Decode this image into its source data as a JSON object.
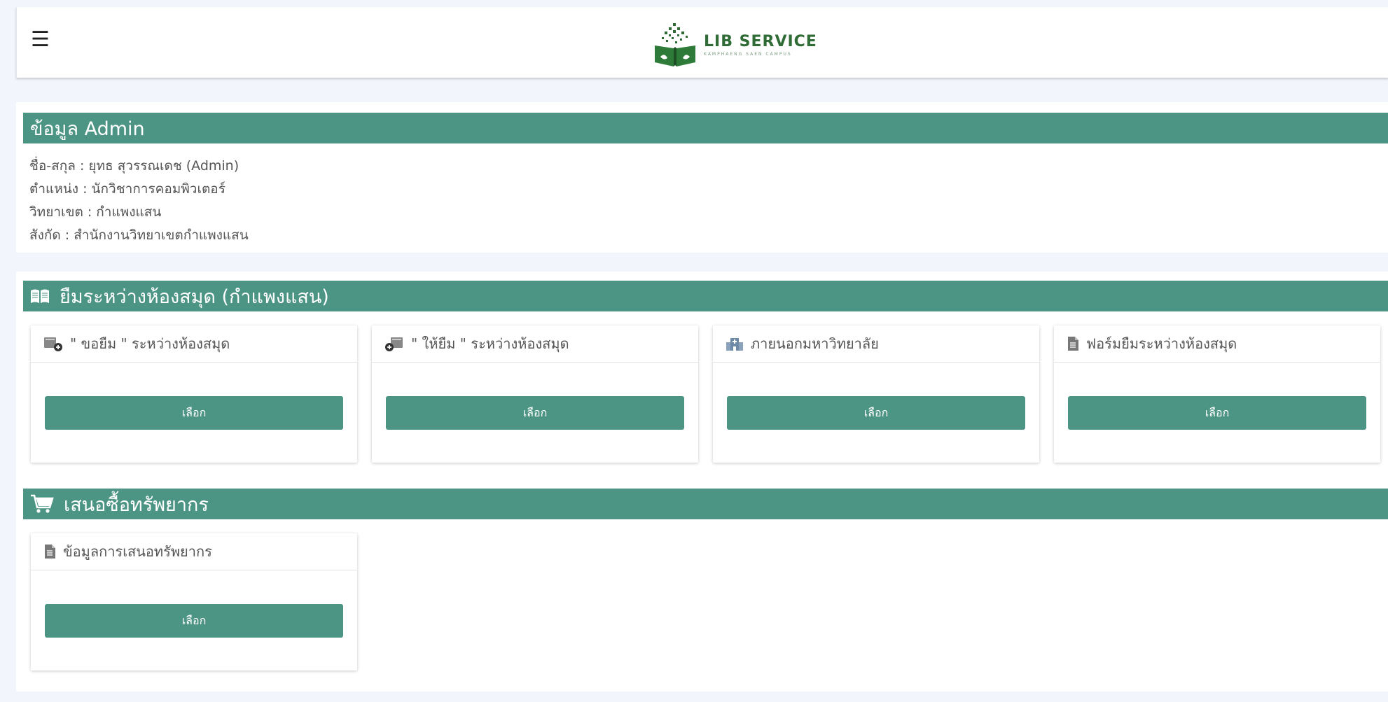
{
  "header": {
    "menu_glyph": "☰",
    "logo_title": "LIB SERVICE",
    "logo_subtitle": "KAMPHAENG SAEN CAMPUS",
    "brand_color": "#2e6b35"
  },
  "admin": {
    "title": "ข้อมูล Admin",
    "fields": [
      {
        "label": "ชื่อ-สกุล : ",
        "value": "ยุทธ สุวรรณเดช (Admin)"
      },
      {
        "label": "ตำแหน่ง : ",
        "value": "นักวิชาการคอมพิวเตอร์"
      },
      {
        "label": "วิทยาเขต : ",
        "value": "กำแพงแสน"
      },
      {
        "label": "สังกัด : ",
        "value": "สำนักงานวิทยาเขตกำแพงแสน"
      }
    ]
  },
  "ill": {
    "title": "ยืมระหว่างห้องสมุด (กำแพงแสน)",
    "icon": "open-book-icon",
    "cards": [
      {
        "title": "\" ขอยืม \" ระหว่างห้องสมุด",
        "icon": "borrow-request-icon",
        "button": "เลือก"
      },
      {
        "title": "\" ให้ยืม \" ระหว่างห้องสมุด",
        "icon": "lend-icon",
        "button": "เลือก"
      },
      {
        "title": "ภายนอกมหาวิทยาลัย",
        "icon": "hospital-building-icon",
        "button": "เลือก"
      },
      {
        "title": "ฟอร์มยืมระหว่างห้องสมุด",
        "icon": "document-icon",
        "button": "เลือก"
      }
    ]
  },
  "purchase": {
    "title": "เสนอซื้อทรัพยากร",
    "icon": "shopping-cart-icon",
    "cards": [
      {
        "title": "ข้อมูลการเสนอทรัพยากร",
        "icon": "document-icon",
        "button": "เลือก"
      }
    ]
  },
  "colors": {
    "accent": "#4c9484",
    "background": "#f2f5fc"
  }
}
